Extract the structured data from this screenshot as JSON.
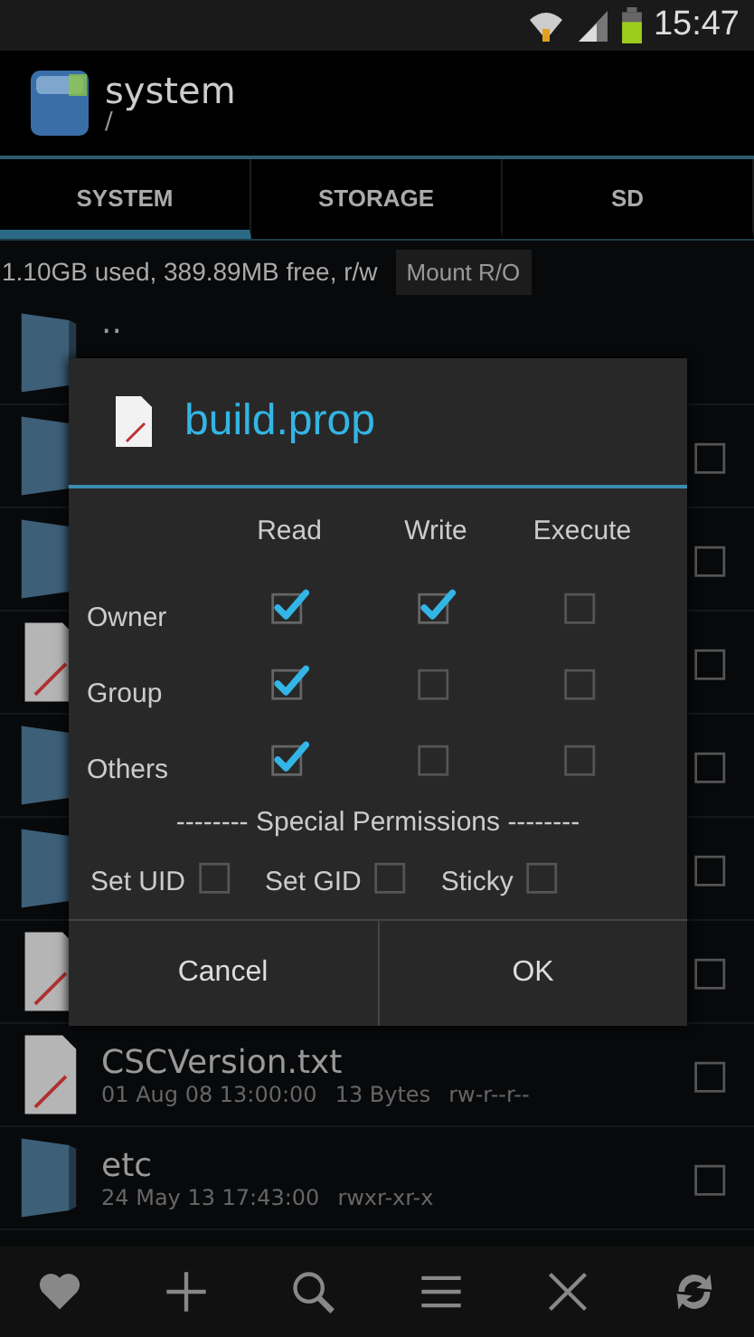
{
  "status_bar": {
    "time": "15:47"
  },
  "header": {
    "title": "system",
    "path": "/"
  },
  "tabs": [
    {
      "label": "SYSTEM",
      "selected": true
    },
    {
      "label": "STORAGE",
      "selected": false
    },
    {
      "label": "SD",
      "selected": false
    }
  ],
  "storage": {
    "info": "1.10GB used, 389.89MB free, r/w",
    "button": "Mount R/O"
  },
  "files": [
    {
      "kind": "folder",
      "name": ".."
    },
    {
      "kind": "folder",
      "checked": false
    },
    {
      "kind": "folder",
      "checked": false
    },
    {
      "kind": "file",
      "checked": false
    },
    {
      "kind": "folder",
      "checked": false
    },
    {
      "kind": "folder",
      "checked": false
    },
    {
      "kind": "file",
      "checked": false
    },
    {
      "kind": "file",
      "name": "CSCVersion.txt",
      "details": [
        "01 Aug 08 13:00:00",
        "13 Bytes",
        "rw-r--r--"
      ],
      "checked": false
    },
    {
      "kind": "folder",
      "name": "etc",
      "details": [
        "24 May 13 17:43:00",
        "rwxr-xr-x"
      ],
      "checked": false
    }
  ],
  "dialog": {
    "title": "build.prop",
    "columns": [
      "Read",
      "Write",
      "Execute"
    ],
    "rows": [
      {
        "label": "Owner",
        "permissions": [
          {
            "checked": true
          },
          {
            "checked": true
          },
          {
            "checked": false
          }
        ]
      },
      {
        "label": "Group",
        "permissions": [
          {
            "checked": true
          },
          {
            "checked": false
          },
          {
            "checked": false
          }
        ]
      },
      {
        "label": "Others",
        "permissions": [
          {
            "checked": true
          },
          {
            "checked": false
          },
          {
            "checked": false
          }
        ]
      }
    ],
    "special_heading": "-------- Special Permissions --------",
    "special": [
      {
        "label": "Set UID",
        "checked": false
      },
      {
        "label": "Set GID",
        "checked": false
      },
      {
        "label": "Sticky",
        "checked": false
      }
    ],
    "buttons": [
      "Cancel",
      "OK"
    ]
  }
}
